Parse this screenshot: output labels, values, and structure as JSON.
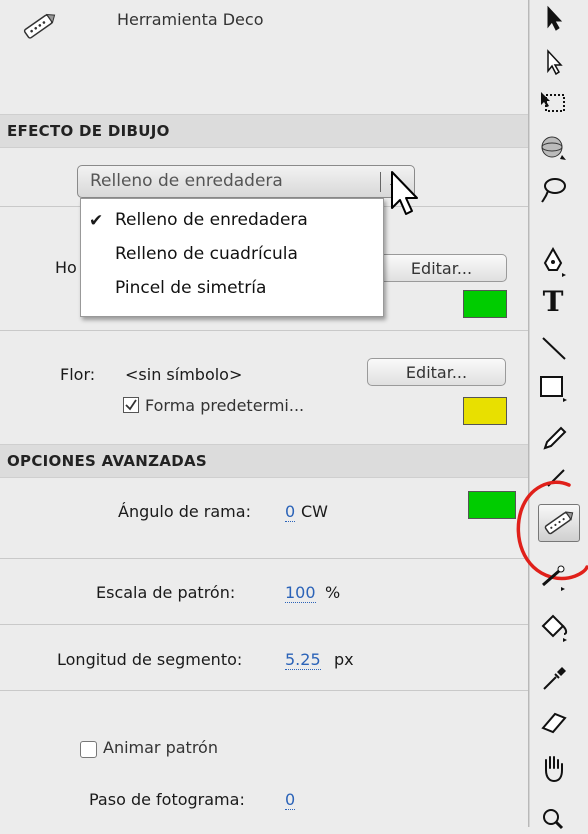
{
  "panel": {
    "tool_title": "Herramienta Deco",
    "section_drawing": "EFECTO DE DIBUJO",
    "effect_select": {
      "selected": "Relleno de enredadera",
      "options": [
        "Relleno de enredadera",
        "Relleno de cuadrícula",
        "Pincel de simetría"
      ],
      "checked_index": 0
    },
    "leaf_label_partial": "Ho",
    "leaf_edit_button": "Editar...",
    "leaf_color": "#00cc00",
    "flower_label": "Flor:",
    "flower_value": "<sin símbolo>",
    "flower_edit_button": "Editar...",
    "default_shape_label": "Forma predetermi...",
    "default_shape_checked": true,
    "flower_color": "#e8e000",
    "section_advanced": "OPCIONES AVANZADAS",
    "branch_angle_label": "Ángulo de rama:",
    "branch_angle_value": "0",
    "branch_angle_unit": "CW",
    "branch_color": "#00cc00",
    "pattern_scale_label": "Escala de patrón:",
    "pattern_scale_value": "100",
    "pattern_scale_unit": "%",
    "segment_length_label": "Longitud de segmento:",
    "segment_length_value": "5.25",
    "segment_length_unit": "px",
    "animate_pattern_label": "Animar patrón",
    "animate_pattern_checked": false,
    "frame_step_label": "Paso de fotograma:",
    "frame_step_value": "0"
  },
  "toolbar": {
    "text_tool_glyph": "T",
    "active_tool": "deco-tool",
    "highlight_color": "#e0201a"
  }
}
